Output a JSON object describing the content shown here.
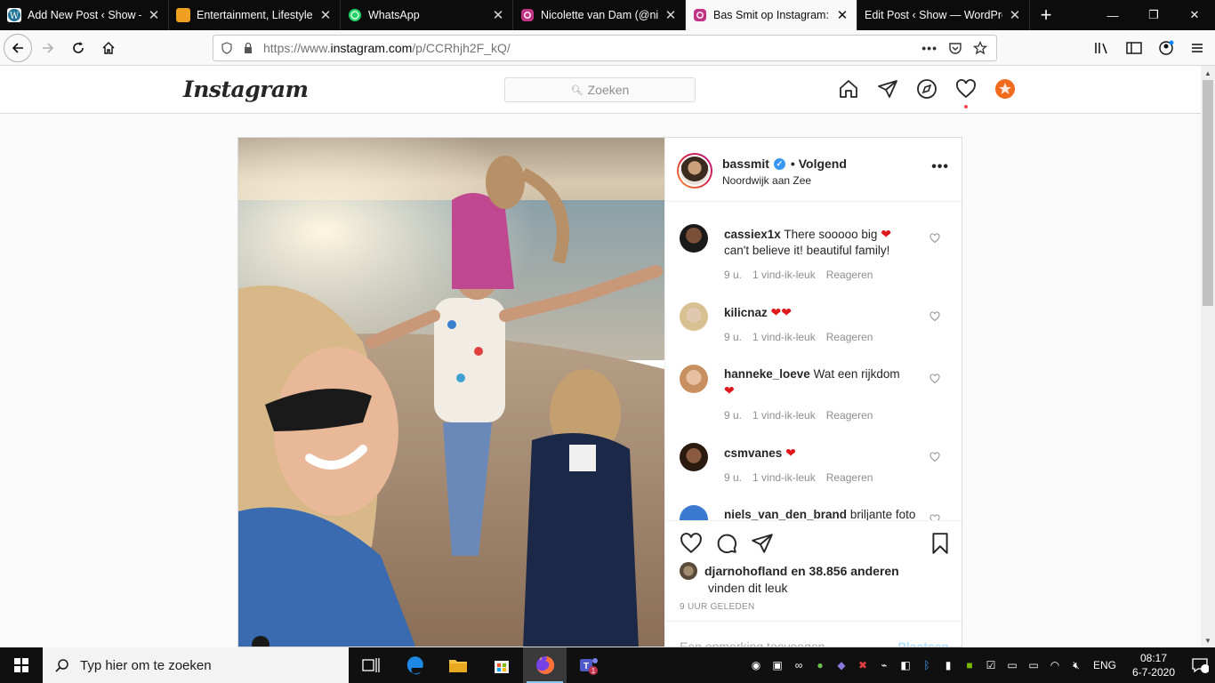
{
  "browser": {
    "tabs": [
      {
        "title": "Add New Post ‹ Show — Wor",
        "favicon": "wordpress-icon",
        "color": "#21759b"
      },
      {
        "title": "Entertainment, Lifestyle,",
        "favicon": "site-icon",
        "color": "#f0a020"
      },
      {
        "title": "WhatsApp",
        "favicon": "whatsapp-icon",
        "color": "#25d366"
      },
      {
        "title": "Nicolette van Dam (@nic",
        "favicon": "instagram-icon",
        "color": "#c13584"
      },
      {
        "title": "Bas Smit op Instagram: \"I",
        "favicon": "instagram-icon",
        "color": "#c13584",
        "active": true
      },
      {
        "title": "Edit Post ‹ Show — WordPres",
        "favicon": "wordpress-icon",
        "color": "#21759b"
      }
    ],
    "url_prefix": "https://www.",
    "url_host": "instagram.com",
    "url_path": "/p/CCRhjh2F_kQ/"
  },
  "instagram": {
    "logo": "Instagram",
    "search_placeholder": "Zoeken",
    "post": {
      "username": "bassmit",
      "follow_status": "• Volgend",
      "location": "Noordwijk aan Zee",
      "comments": [
        {
          "user": "cassiex1x",
          "text": "There sooooo big",
          "text2": "can't believe it! beautiful family!",
          "hearts": 1,
          "time": "9 u.",
          "likes": "1 vind-ik-leuk",
          "reply": "Reageren",
          "avatar_color": "#3a2a28"
        },
        {
          "user": "kilicnaz",
          "text": "",
          "hearts": 2,
          "time": "9 u.",
          "likes": "1 vind-ik-leuk",
          "reply": "Reageren",
          "avatar_color": "#d8c8a8"
        },
        {
          "user": "hanneke_loeve",
          "text": "Wat een rijkdom",
          "hearts_line2": 1,
          "time": "9 u.",
          "likes": "1 vind-ik-leuk",
          "reply": "Reageren",
          "avatar_color": "#c89060"
        },
        {
          "user": "csmvanes",
          "text": "",
          "hearts": 1,
          "time": "9 u.",
          "likes": "1 vind-ik-leuk",
          "reply": "Reageren",
          "avatar_color": "#5a3a28"
        },
        {
          "user": "niels_van_den_brand",
          "text": "briljante foto",
          "avatar_color": "#3a7ad0"
        }
      ],
      "liked_by_user": "djarnohofland",
      "liked_by_rest": "en 38.856 anderen",
      "liked_suffix": "vinden dit leuk",
      "time_ago": "9 UUR GELEDEN",
      "add_comment_placeholder": "Een opmerking toevoegen...",
      "post_button": "Plaatsen"
    }
  },
  "taskbar": {
    "search_placeholder": "Typ hier om te zoeken",
    "language": "ENG",
    "time": "08:17",
    "date": "6-7-2020",
    "notification_count": "3"
  }
}
